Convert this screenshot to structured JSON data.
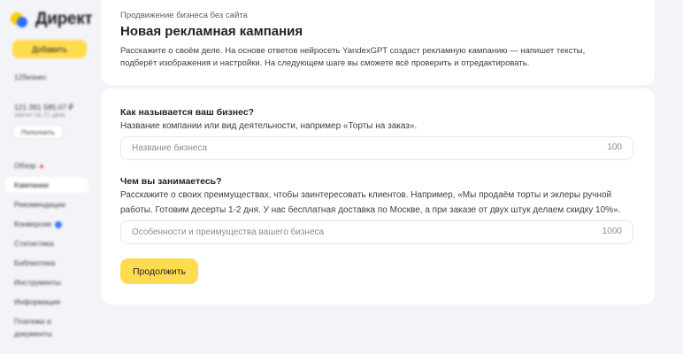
{
  "sidebar": {
    "logo_text": "Директ",
    "add_button": "Добавить",
    "client_id": "12бизнес",
    "balance": "121 391 585,07 ₽",
    "balance_note": "хватит на 21 день",
    "topup_button": "Пополнить",
    "nav": [
      {
        "label": "Обзор"
      },
      {
        "label": "Кампании"
      },
      {
        "label": "Рекомендации"
      },
      {
        "label": "Конверсии"
      },
      {
        "label": "Статистика"
      },
      {
        "label": "Библиотека"
      },
      {
        "label": "Инструменты"
      },
      {
        "label": "Информация"
      },
      {
        "label": "Платежи и"
      },
      {
        "label": "документы"
      }
    ]
  },
  "header": {
    "breadcrumb": "Продвижение бизнеса без сайта",
    "title": "Новая рекламная кампания",
    "description": "Расскажите о своём деле. На основе ответов нейросеть YandexGPT создаст рекламную кампанию — напишет тексты, подберёт изображения и настройки. На следующем шаге вы сможете всё проверить и отредактировать."
  },
  "form": {
    "business_name": {
      "question": "Как называется ваш бизнес?",
      "help": "Название компании или вид деятельности, например «Торты на заказ».",
      "placeholder": "Название бизнеса",
      "value": "",
      "max_length": "100"
    },
    "business_activity": {
      "question": "Чем вы занимаетесь?",
      "help": "Расскажите о своих преимуществах, чтобы заинтересовать клиентов. Например, «Мы продаём торты и эклеры ручной работы. Готовим десерты 1-2 дня. У нас бесплатная доставка по Москве, а при заказе от двух штук делаем скидку 10%».",
      "placeholder": "Особенности и преимущества вашего бизнеса",
      "value": "",
      "max_length": "1000"
    },
    "continue_button": "Продолжить"
  }
}
